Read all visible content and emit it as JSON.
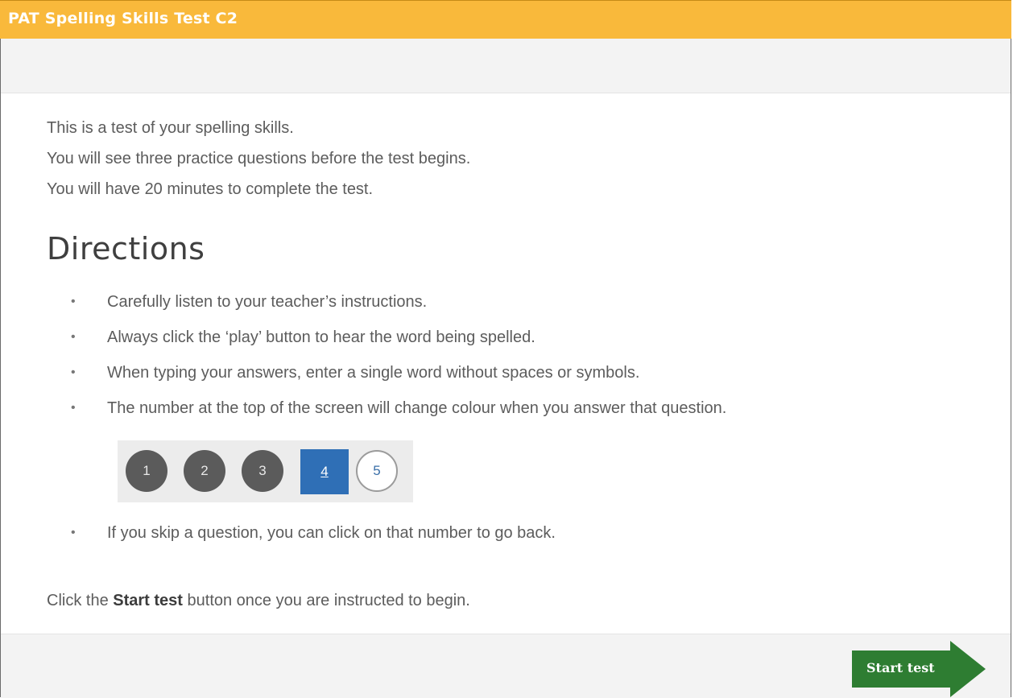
{
  "header": {
    "title": "PAT Spelling Skills Test C2"
  },
  "intro": {
    "lines": [
      "This is a test of your spelling skills.",
      "You will see three practice questions before the test begins.",
      "You will have 20 minutes to complete the test."
    ]
  },
  "directions": {
    "heading": "Directions",
    "items": [
      "Carefully listen to your teacher’s instructions.",
      "Always click the ‘play’ button to hear the word being spelled.",
      "When typing your answers, enter a single word without spaces or symbols.",
      "The number at the top of the screen will change colour when you answer that question."
    ],
    "skip_item": "If you skip a question, you can click on that number to go back.",
    "bullet": "•",
    "nav_example": {
      "numbers": [
        "1",
        "2",
        "3",
        "4",
        "5"
      ],
      "states": [
        "answered",
        "answered",
        "answered",
        "current",
        "unanswered"
      ]
    }
  },
  "start": {
    "instruction_prefix": "Click the ",
    "instruction_bold": "Start test",
    "instruction_suffix": " button once you are instructed to begin.",
    "button_label": "Start test"
  },
  "colors": {
    "header": "#f9b93b",
    "answered": "#5b5b5b",
    "current": "#2f6fb6",
    "start_button": "#2e7d32"
  }
}
